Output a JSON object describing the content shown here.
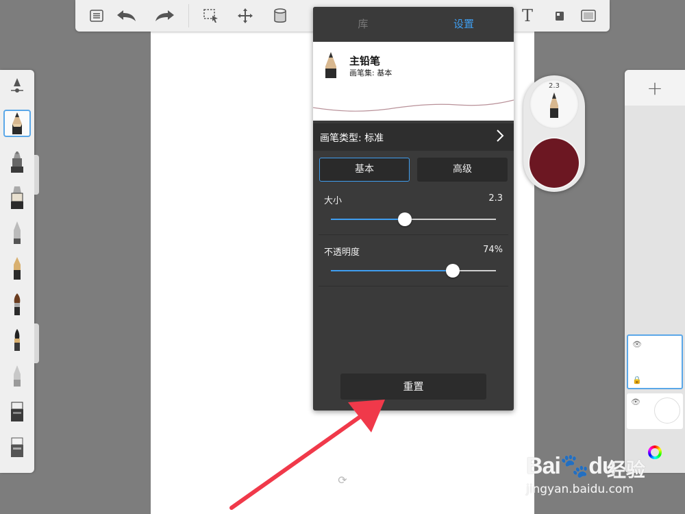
{
  "panel": {
    "tabs": [
      {
        "label": "库"
      },
      {
        "label": "设置"
      }
    ],
    "brush_name": "主铅笔",
    "brush_set": "画笔集: 基本",
    "brush_type": "画笔类型: 标准",
    "segments": {
      "basic": "基本",
      "advanced": "高级"
    },
    "size": {
      "label": "大小",
      "value": "2.3",
      "fraction": 0.45
    },
    "opacity": {
      "label": "不透明度",
      "value": "74%",
      "fraction": 0.74
    },
    "reset_label": "重置"
  },
  "puck": {
    "size_label": "2.3",
    "color": "#6c1722"
  },
  "right_rail": {
    "add_label": "+"
  },
  "watermark": {
    "logo": "Bai🐾du",
    "cn": "经验",
    "url": "jingyan.baidu.com"
  },
  "colors": {
    "accent": "#3f9ef0",
    "annotation_arrow": "#f0394a",
    "brush_color": "#6c1722"
  },
  "icons": [
    "layers-list-icon",
    "undo-icon",
    "redo-icon",
    "selection-icon",
    "transform-icon",
    "fill-bucket-icon",
    "text-icon",
    "stamp-icon",
    "fullscreen-icon",
    "brush-properties-icon",
    "pencil-icon",
    "airbrush-icon",
    "marker-icon",
    "pen-icon",
    "fountain-pen-icon",
    "paintbrush-icon",
    "calligraphy-brush-icon",
    "blender-icon",
    "eraser-icon",
    "soft-eraser-icon",
    "eye-icon",
    "lock-icon",
    "color-wheel-icon"
  ]
}
